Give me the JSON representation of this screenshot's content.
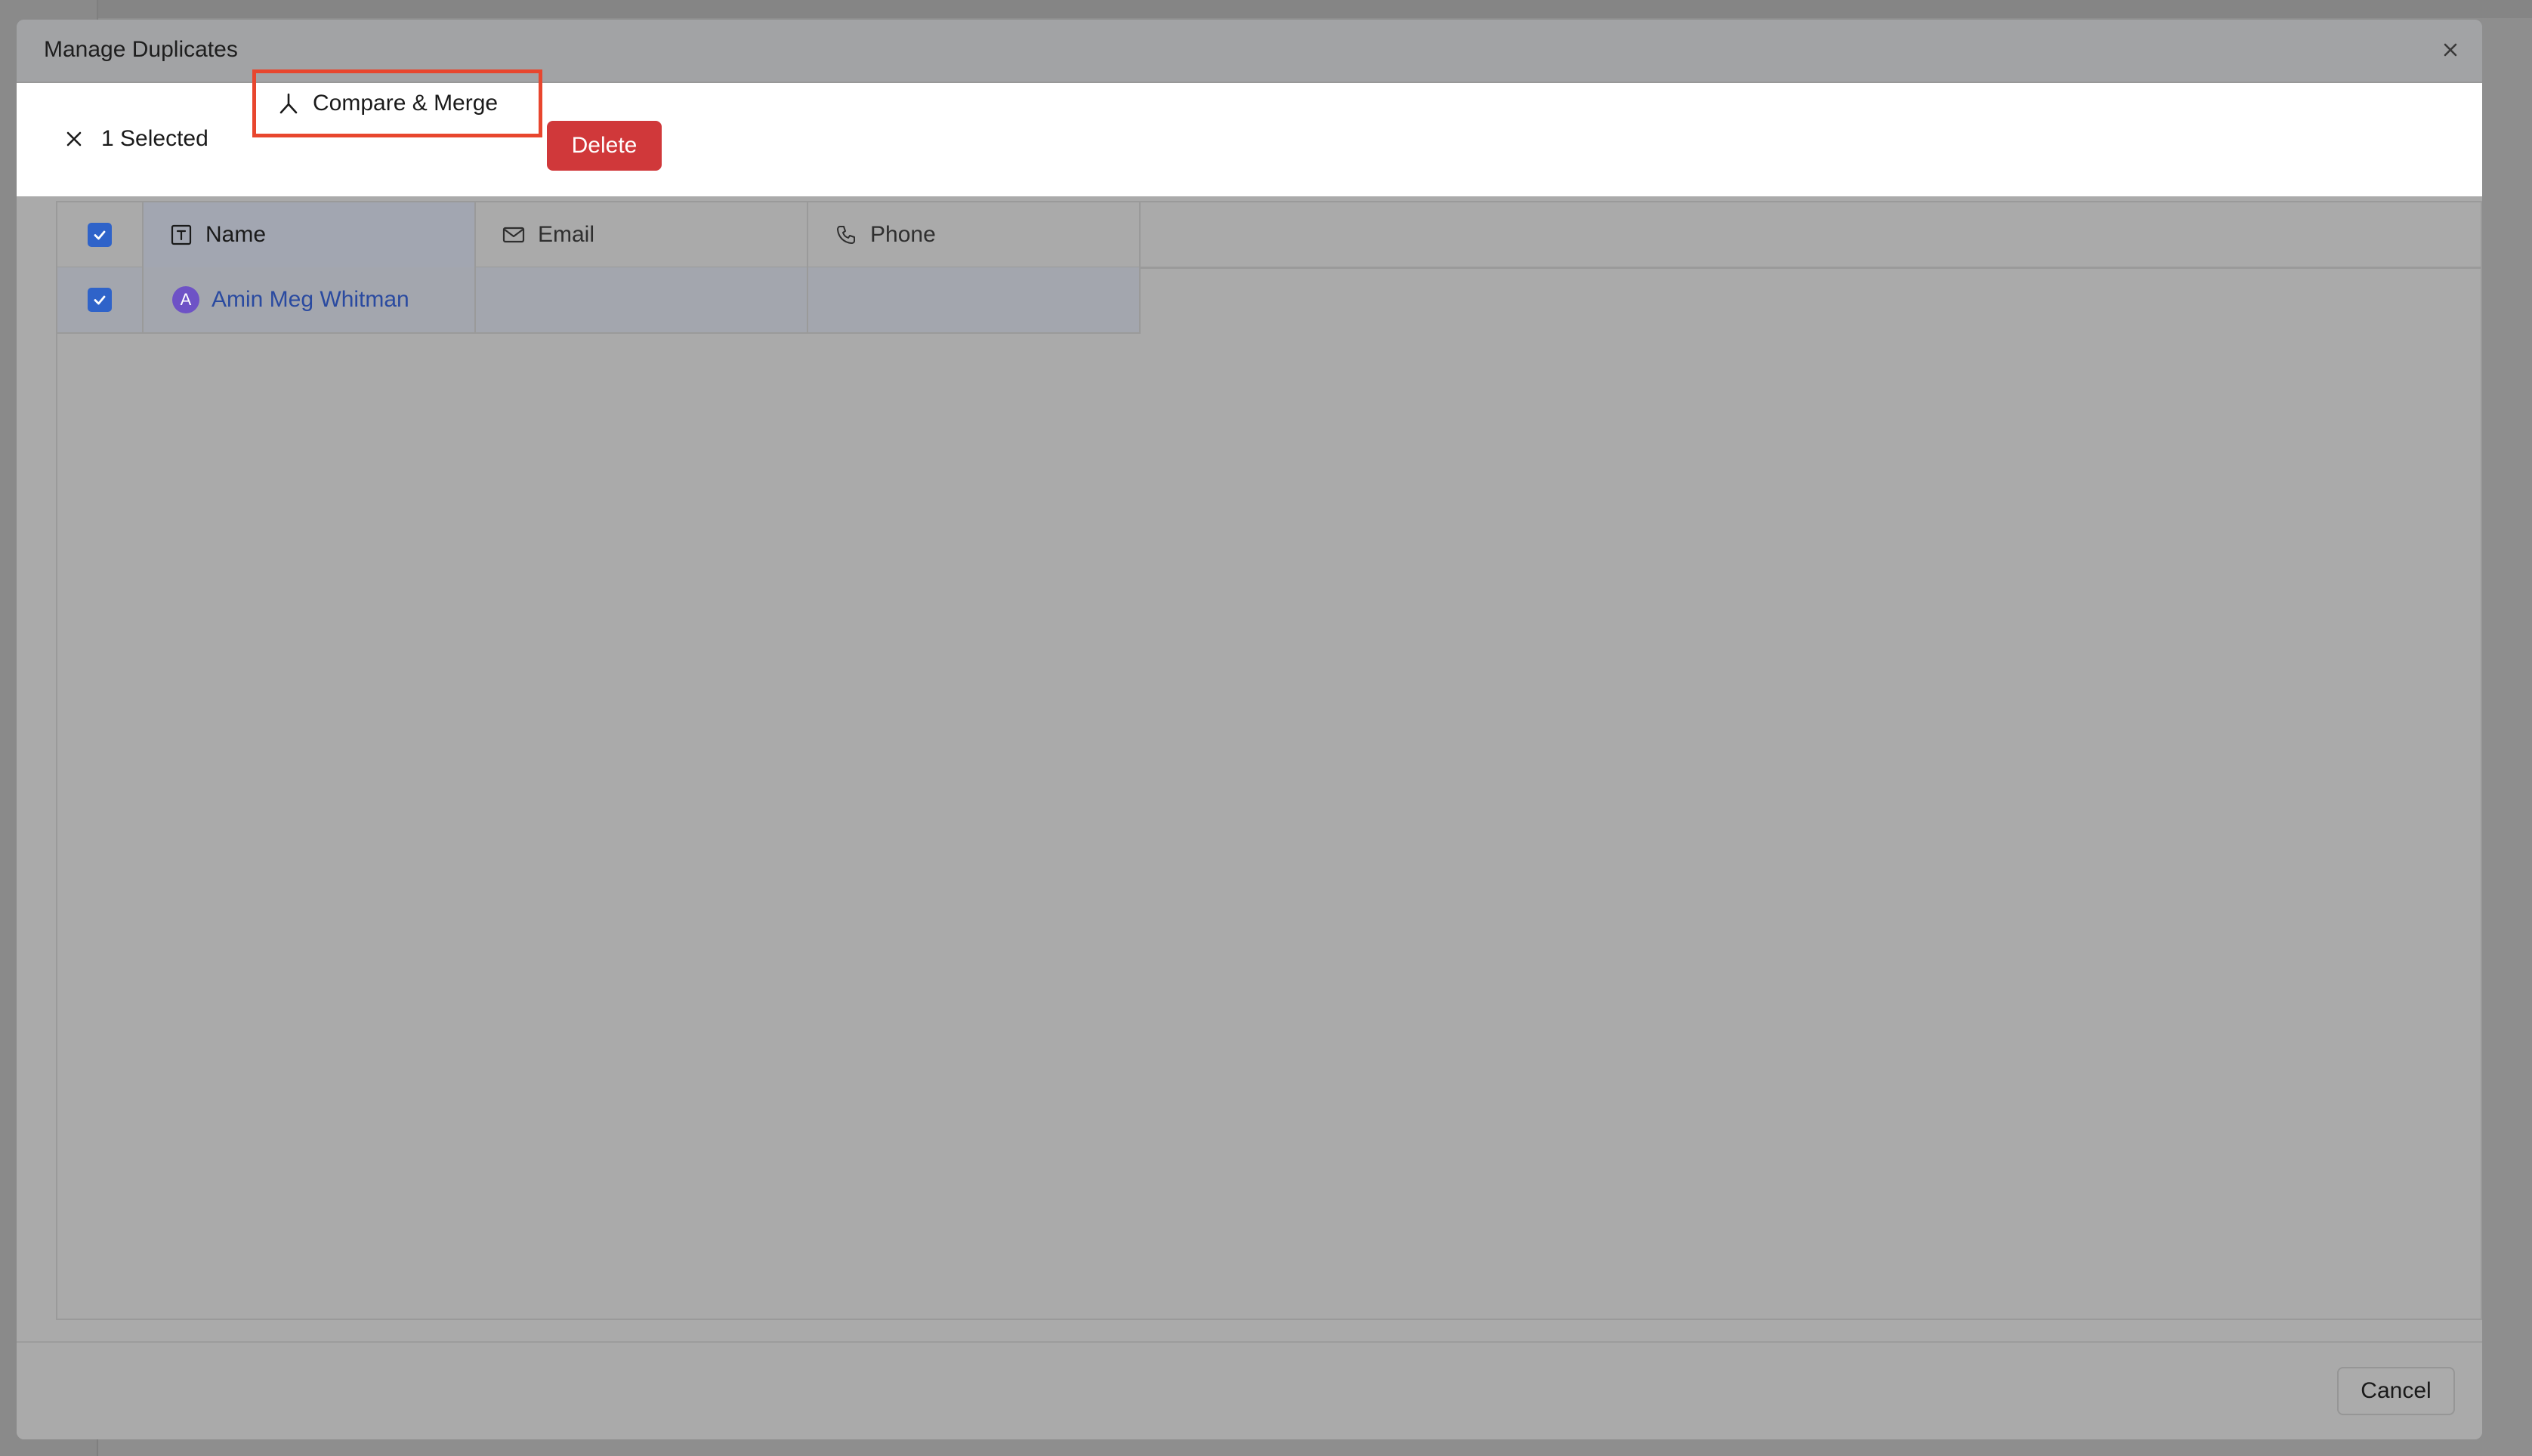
{
  "modal": {
    "title": "Manage Duplicates",
    "close_icon": "close-icon"
  },
  "toolbar": {
    "selection_count_label": "1 Selected",
    "deselect_icon": "x-icon",
    "compare_merge_label": "Compare & Merge",
    "compare_merge_icon": "merge-icon",
    "delete_label": "Delete",
    "highlight_color": "#e8462e",
    "delete_color": "#d0383a"
  },
  "table": {
    "columns": [
      {
        "key": "name",
        "label": "Name",
        "icon": "text-field-icon"
      },
      {
        "key": "email",
        "label": "Email",
        "icon": "mail-icon"
      },
      {
        "key": "phone",
        "label": "Phone",
        "icon": "phone-icon"
      }
    ],
    "header_checkbox_checked": true,
    "rows": [
      {
        "checked": true,
        "avatar_initial": "A",
        "avatar_color": "#6e52c6",
        "name": "Amin Meg Whitman",
        "email": "",
        "phone": ""
      }
    ]
  },
  "footer": {
    "cancel_label": "Cancel"
  },
  "colors": {
    "checkbox": "#2f63c9",
    "link": "#2a4aa0"
  }
}
